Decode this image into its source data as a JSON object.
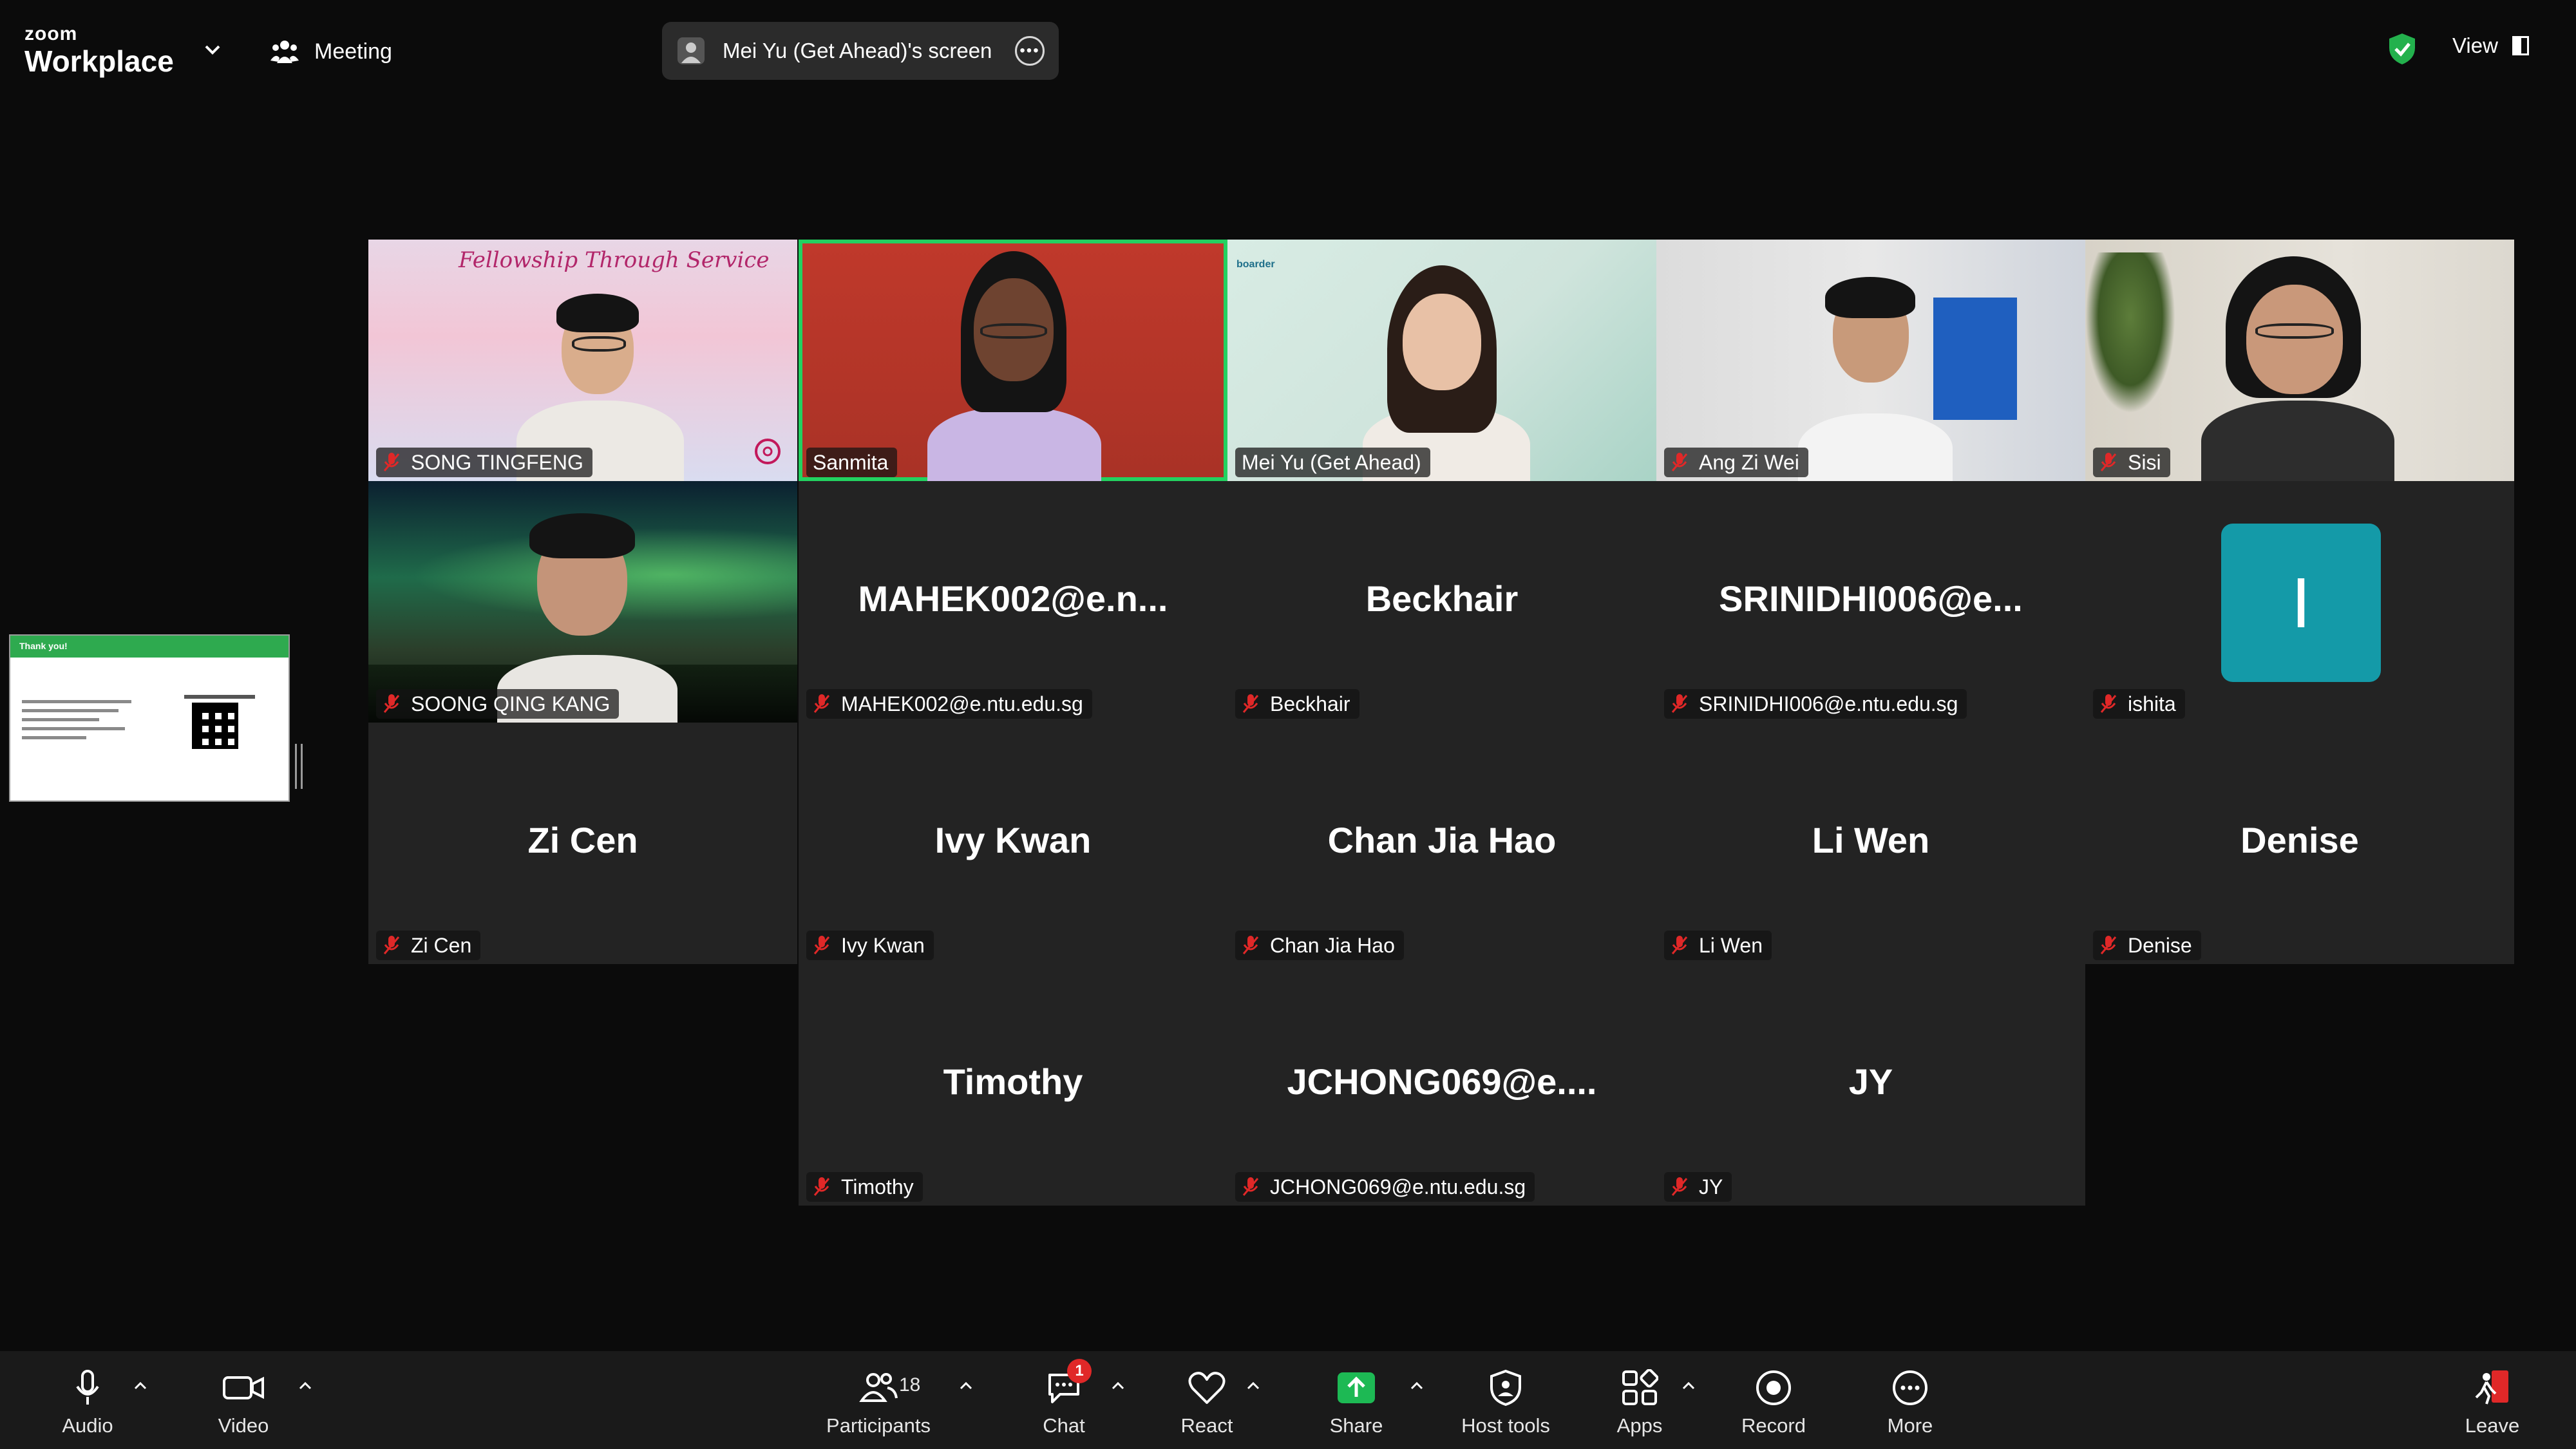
{
  "topbar": {
    "logo_small": "zoom",
    "logo_big": "Workplace",
    "meeting_label": "Meeting",
    "screen_share_label": "Mei Yu (Get Ahead)'s screen",
    "view_label": "View",
    "security_color": "#23b14d"
  },
  "shared_screen": {
    "header": "Thank you!"
  },
  "gallery": {
    "participants": [
      {
        "display_name": "SONG TINGFENG",
        "tag": "SONG TINGFENG",
        "video": true,
        "muted": true
      },
      {
        "display_name": "Sanmita",
        "tag": "Sanmita",
        "video": true,
        "muted": false,
        "active_speaker": true
      },
      {
        "display_name": "Mei Yu (Get Ahead)",
        "tag": "Mei Yu (Get Ahead)",
        "video": true,
        "muted": false
      },
      {
        "display_name": "Ang Zi Wei",
        "tag": "Ang Zi Wei",
        "video": true,
        "muted": true
      },
      {
        "display_name": "Sisi",
        "tag": "Sisi",
        "video": true,
        "muted": true
      },
      {
        "display_name": "SOONG QING KANG",
        "tag": "SOONG QING KANG",
        "video": true,
        "muted": true
      },
      {
        "display_name": "MAHEK002@e.n...",
        "tag": "MAHEK002@e.ntu.edu.sg",
        "video": false,
        "muted": true
      },
      {
        "display_name": "Beckhair",
        "tag": "Beckhair",
        "video": false,
        "muted": true
      },
      {
        "display_name": "SRINIDHI006@e...",
        "tag": "SRINIDHI006@e.ntu.edu.sg",
        "video": false,
        "muted": true
      },
      {
        "display_name": "I",
        "tag": "ishita",
        "video": false,
        "muted": true
      },
      {
        "display_name": "Zi Cen",
        "tag": "Zi Cen",
        "video": false,
        "muted": true
      },
      {
        "display_name": "Ivy Kwan",
        "tag": "Ivy Kwan",
        "video": false,
        "muted": true
      },
      {
        "display_name": "Chan Jia Hao",
        "tag": "Chan Jia Hao",
        "video": false,
        "muted": true
      },
      {
        "display_name": "Li Wen",
        "tag": "Li Wen",
        "video": false,
        "muted": true
      },
      {
        "display_name": "Denise",
        "tag": "Denise",
        "video": false,
        "muted": true
      },
      {
        "display_name": "Timothy",
        "tag": "Timothy",
        "video": false,
        "muted": true
      },
      {
        "display_name": "JCHONG069@e....",
        "tag": "JCHONG069@e.ntu.edu.sg",
        "video": false,
        "muted": true
      },
      {
        "display_name": "JY",
        "tag": "JY",
        "video": false,
        "muted": true
      }
    ],
    "tile1_banner": "Fellowship Through Service",
    "tile3_logo": "boarder"
  },
  "toolbar": {
    "audio": "Audio",
    "video": "Video",
    "participants": "Participants",
    "participant_count": "18",
    "chat": "Chat",
    "chat_badge": "1",
    "react": "React",
    "share": "Share",
    "host_tools": "Host tools",
    "apps": "Apps",
    "record": "Record",
    "more": "More",
    "leave": "Leave",
    "share_color": "#1db954",
    "leave_color": "#e02828"
  }
}
